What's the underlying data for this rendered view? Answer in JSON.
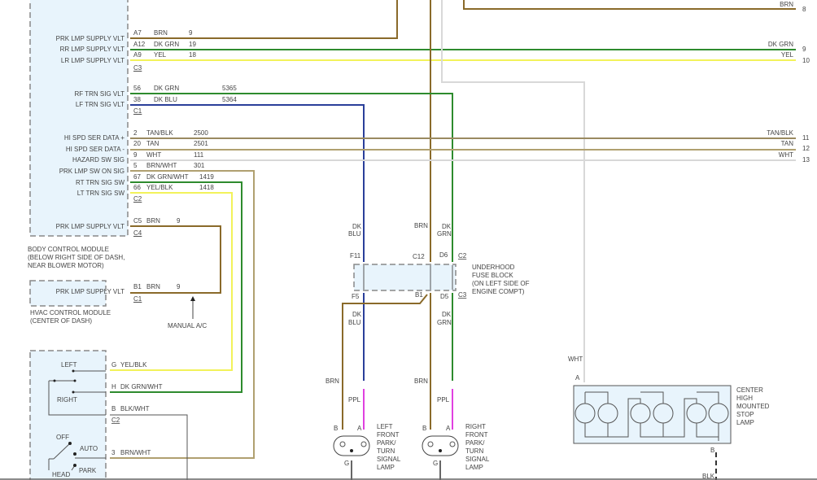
{
  "colors": {
    "BRN": "#8a6a2a",
    "DK_GRN": "#2e8b2e",
    "YEL": "#f2f25a",
    "DK_BLU": "#2a3f9a",
    "TAN": "#b0a070",
    "TAN_BLK": "#9a8a60",
    "WHT": "#d8d8d8",
    "PPL": "#e040e0",
    "BLK_WHT": "#666666",
    "BLK": "#333333"
  },
  "bcm": {
    "name_lines": [
      "BODY CONTROL MODULE",
      "(BELOW RIGHT SIDE OF DASH,",
      "NEAR BLOWER MOTOR)"
    ],
    "pins": [
      {
        "label": "PRK LMP SUPPLY VLT",
        "pin": "A7",
        "wire": "BRN",
        "circuit": "9"
      },
      {
        "label": "RR LMP SUPPLY VLT",
        "pin": "A12",
        "wire": "DK GRN",
        "circuit": "19"
      },
      {
        "label": "LR LMP SUPPLY VLT",
        "pin": "A9",
        "wire": "YEL",
        "circuit": "18"
      },
      {
        "label": "RF TRN SIG VLT",
        "pin": "56",
        "wire": "DK GRN",
        "circuit": "5365"
      },
      {
        "label": "LF TRN SIG VLT",
        "pin": "38",
        "wire": "DK BLU",
        "circuit": "5364"
      },
      {
        "label": "HI SPD SER DATA +",
        "pin": "2",
        "wire": "TAN/BLK",
        "circuit": "2500"
      },
      {
        "label": "HI SPD SER DATA -",
        "pin": "20",
        "wire": "TAN",
        "circuit": "2501"
      },
      {
        "label": "HAZARD SW SIG",
        "pin": "9",
        "wire": "WHT",
        "circuit": "111"
      },
      {
        "label": "PRK LMP SW ON SIG",
        "pin": "5",
        "wire": "BRN/WHT",
        "circuit": "301"
      },
      {
        "label": "RT TRN SIG SW",
        "pin": "67",
        "wire": "DK GRN/WHT",
        "circuit": "1419"
      },
      {
        "label": "LT TRN SIG SW",
        "pin": "66",
        "wire": "YEL/BLK",
        "circuit": "1418"
      },
      {
        "label": "PRK LMP SUPPLY VLT",
        "pin": "C5",
        "wire": "BRN",
        "circuit": "9"
      }
    ],
    "connectors": [
      "C3",
      "C1",
      "C2",
      "C4"
    ]
  },
  "hvac": {
    "name_lines": [
      "HVAC CONTROL MODULE",
      "(CENTER OF DASH)"
    ],
    "pin_label": "PRK LMP SUPPLY VLT",
    "pin": "B1",
    "wire": "BRN",
    "circuit": "9",
    "connector": "C1",
    "note": "MANUAL A/C"
  },
  "offpage": [
    {
      "wire": "BRN",
      "ref": "8"
    },
    {
      "wire": "DK GRN",
      "ref": "9"
    },
    {
      "wire": "YEL",
      "ref": "10"
    },
    {
      "wire": "TAN/BLK",
      "ref": "11"
    },
    {
      "wire": "TAN",
      "ref": "12"
    },
    {
      "wire": "WHT",
      "ref": "13"
    }
  ],
  "switch": {
    "labels": {
      "left": "LEFT",
      "right": "RIGHT",
      "off": "OFF",
      "auto": "AUTO",
      "park": "PARK",
      "head": "HEAD"
    },
    "pins": [
      {
        "pin": "G",
        "wire": "YEL/BLK"
      },
      {
        "pin": "H",
        "wire": "DK GRN/WHT"
      },
      {
        "pin": "B",
        "wire": "BLK/WHT"
      },
      {
        "pin": "3",
        "wire": "BRN/WHT"
      }
    ],
    "connector": "C2"
  },
  "fuse_block": {
    "name_lines": [
      "UNDERHOOD",
      "FUSE BLOCK",
      "(ON LEFT SIDE OF",
      "ENGINE COMPT)"
    ],
    "top_pins": [
      "F11",
      "C12",
      "D6"
    ],
    "top_connector": "C2",
    "bottom_pins": [
      "F5",
      "B1",
      "D5"
    ],
    "bottom_connector": "C3",
    "wire_labels": {
      "dk": "DK",
      "blu": "BLU",
      "grn": "GRN",
      "brn": "BRN",
      "ppl": "PPL"
    }
  },
  "left_lamp": {
    "name_lines": [
      "LEFT",
      "FRONT",
      "PARK/",
      "TURN",
      "SIGNAL",
      "LAMP"
    ],
    "pins": [
      "B",
      "A",
      "G"
    ]
  },
  "right_lamp": {
    "name_lines": [
      "RIGHT",
      "FRONT",
      "PARK/",
      "TURN",
      "SIGNAL",
      "LAMP"
    ],
    "pins": [
      "B",
      "A",
      "G"
    ]
  },
  "chmsl": {
    "name_lines": [
      "CENTER",
      "HIGH",
      "MOUNTED",
      "STOP",
      "LAMP"
    ],
    "pin_a": "A",
    "pin_b": "B",
    "wire_in": "WHT",
    "wire_out": "BLK"
  }
}
